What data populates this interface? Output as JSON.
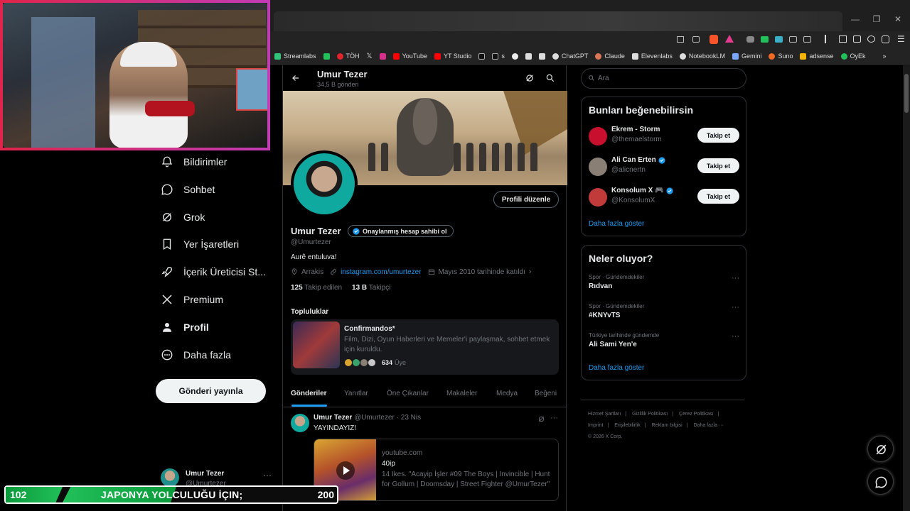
{
  "browser": {
    "bookmarks": [
      "Streamlabs",
      "TÖH",
      "YouTube",
      "YT Studio",
      "s",
      "ChatGPT",
      "Claude",
      "Elevenlabs",
      "NotebookLM",
      "Gemini",
      "Suno",
      "adsense",
      "OyEk"
    ],
    "overflow": "»"
  },
  "nav": {
    "items": [
      {
        "label": "Bildirimler",
        "icon": "bell-icon"
      },
      {
        "label": "Sohbet",
        "icon": "chat-icon"
      },
      {
        "label": "Grok",
        "icon": "grok-icon"
      },
      {
        "label": "Yer İşaretleri",
        "icon": "bookmark-icon"
      },
      {
        "label": "İçerik Üreticisi St...",
        "icon": "rocket-icon"
      },
      {
        "label": "Premium",
        "icon": "x-logo-icon"
      },
      {
        "label": "Profil",
        "icon": "person-icon"
      },
      {
        "label": "Daha fazla",
        "icon": "more-circle-icon"
      }
    ],
    "post_button": "Gönderi yayınla",
    "account": {
      "name": "Umur Tezer",
      "handle": "@Umurtezer",
      "more": "···"
    }
  },
  "overlay": {
    "left": "102",
    "text": "JAPONYA YOLCULUĞU İÇIN;",
    "right": "200"
  },
  "profile": {
    "top_name": "Umur Tezer",
    "top_count": "34,5 B gönderi",
    "edit_button": "Profili düzenle",
    "name": "Umur Tezer",
    "verify_label": "Onaylanmış hesap sahibi ol",
    "handle": "@Umurtezer",
    "bio": "Aurê entuluva!",
    "location": "Arrakis",
    "link": "instagram.com/umurtezer",
    "joined": "Mayıs 2010 tarihinde katıldı",
    "following_count": "125",
    "following_label": "Takip edilen",
    "followers_count": "13 B",
    "followers_label": "Takipçi",
    "communities_title": "Topluluklar",
    "community": {
      "name": "Confirmandos*",
      "desc": "Film, Dizi, Oyun Haberleri ve Memeler'i paylaşmak, sohbet etmek için kuruldu.",
      "members": "634",
      "members_label": "Üye"
    },
    "tabs": [
      "Gönderiler",
      "Yanıtlar",
      "Öne Çıkanlar",
      "Makaleler",
      "Medya",
      "Beğeni"
    ],
    "post": {
      "name": "Umur Tezer",
      "handle": "@Umurtezer",
      "date": "· 23 Nis",
      "text": "YAYINDAYIZ!",
      "more": "···",
      "card_domain": "youtube.com",
      "card_title": "40ip",
      "card_desc": "14 Ikes. \"Acayip İşler #09 The Boys | Invincible | Hunt for Gollum | Doomsday | Street Fighter @UmurTezer\""
    }
  },
  "right": {
    "search_placeholder": "Ara",
    "who_title": "Bunları beğenebilirsin",
    "who": [
      {
        "name": "Ekrem - Storm",
        "handle": "@themaelstorm",
        "verified": false,
        "button": "Takip et",
        "color": "#c8102e"
      },
      {
        "name": "Ali Can Erten",
        "handle": "@alicnertn",
        "verified": true,
        "button": "Takip et",
        "color": "#8a7f75"
      },
      {
        "name": "Konsolum X 🎮",
        "handle": "@KonsolumX",
        "verified": true,
        "button": "Takip et",
        "color": "#c23b3b"
      }
    ],
    "who_more": "Daha fazla göster",
    "trends_title": "Neler oluyor?",
    "trends": [
      {
        "cat": "Spor · Gündemdekiler",
        "title": "Rıdvan",
        "more": "···"
      },
      {
        "cat": "Spor · Gündemdekiler",
        "title": "#KNYvTS",
        "more": "···"
      },
      {
        "cat": "Türkiye tarihinde gündemde",
        "title": "Ali Sami Yen'e",
        "more": "···"
      }
    ],
    "trends_more": "Daha fazla göster",
    "footer": [
      "Hizmet Şartları",
      "|",
      "Gizlilik Politikası",
      "|",
      "Çerez Politikası",
      "|",
      "Imprint",
      "|",
      "Erişilebilirlik",
      "|",
      "Reklam bilgisi",
      "|",
      "Daha fazla ···",
      "© 2026 X Corp."
    ]
  },
  "colors": {
    "accent": "#1d9bf0",
    "background": "#000000",
    "border": "#2f3336"
  }
}
